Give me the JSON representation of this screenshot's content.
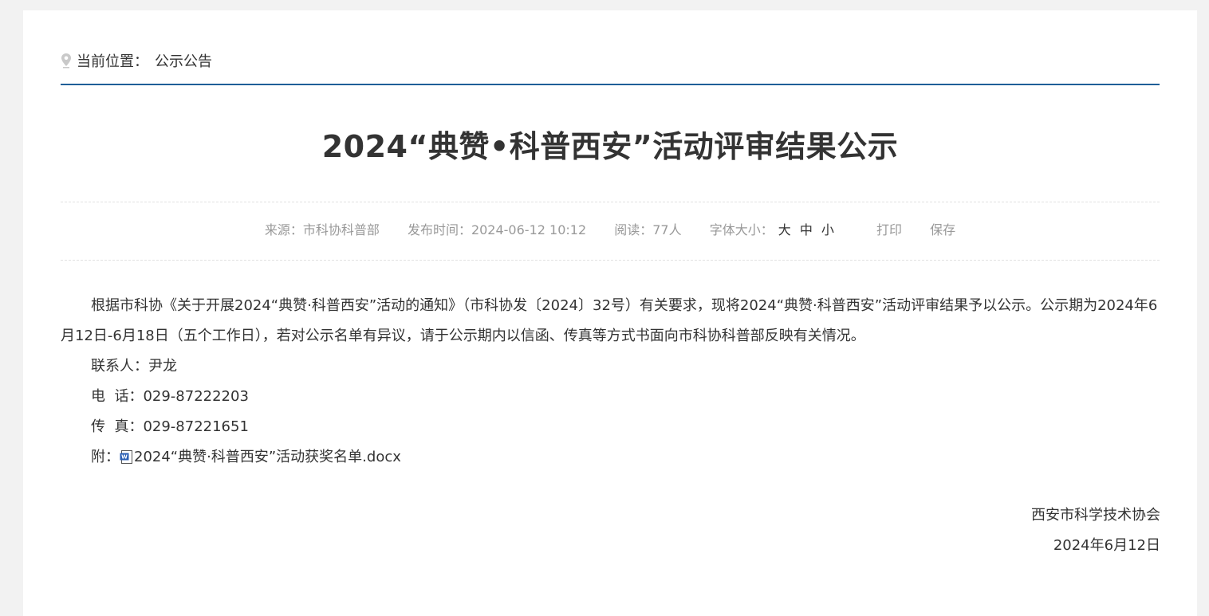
{
  "breadcrumb": {
    "label": "当前位置：",
    "current": "公示公告"
  },
  "article": {
    "title": "2024“典赞•科普西安”活动评审结果公示",
    "meta": {
      "source": "来源：市科协科普部",
      "published": "发布时间：2024-06-12 10:12",
      "reads": "阅读：77人",
      "font_size_label": "字体大小：",
      "size_large": "大",
      "size_medium": "中",
      "size_small": "小",
      "print": "打印",
      "save": "保存"
    },
    "body": {
      "paragraph": "根据市科协《关于开展2024“典赞·科普西安”活动的通知》（市科协发〔2024〕32号）有关要求，现将2024“典赞·科普西安”活动评审结果予以公示。公示期为2024年6月12日-6月18日（五个工作日），若对公示名单有异议，请于公示期内以信函、传真等方式书面向市科协科普部反映有关情况。",
      "contact": "联系人：尹龙",
      "phone": "电  话：029-87222203",
      "fax": "传  真：029-87221651",
      "attachment_label": "附：",
      "attachment_name": "2024“典赞·科普西安”活动获奖名单.docx"
    },
    "signature": {
      "org": "西安市科学技术协会",
      "date": "2024年6月12日"
    }
  },
  "colors": {
    "accent_rule": "#1f5f98",
    "background": "#f2f2f2"
  },
  "icons": [
    "location-pin-icon",
    "word-doc-icon"
  ]
}
